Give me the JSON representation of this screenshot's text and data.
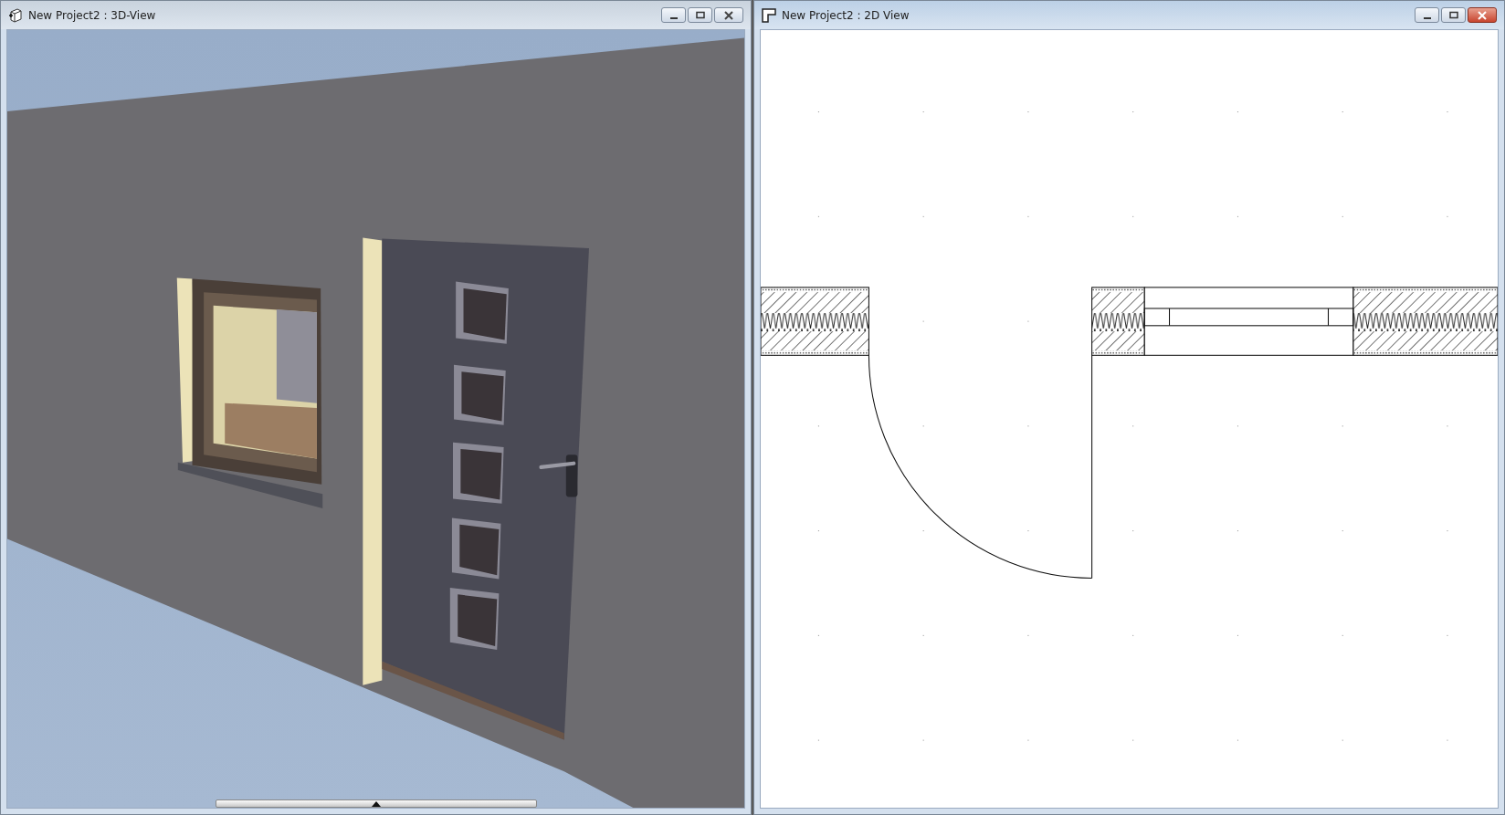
{
  "windows": [
    {
      "title": "New Project2 : 3D-View",
      "kind": "perspective",
      "active": false
    },
    {
      "title": "New Project2 : 2D View",
      "kind": "plan",
      "active": true
    }
  ]
}
